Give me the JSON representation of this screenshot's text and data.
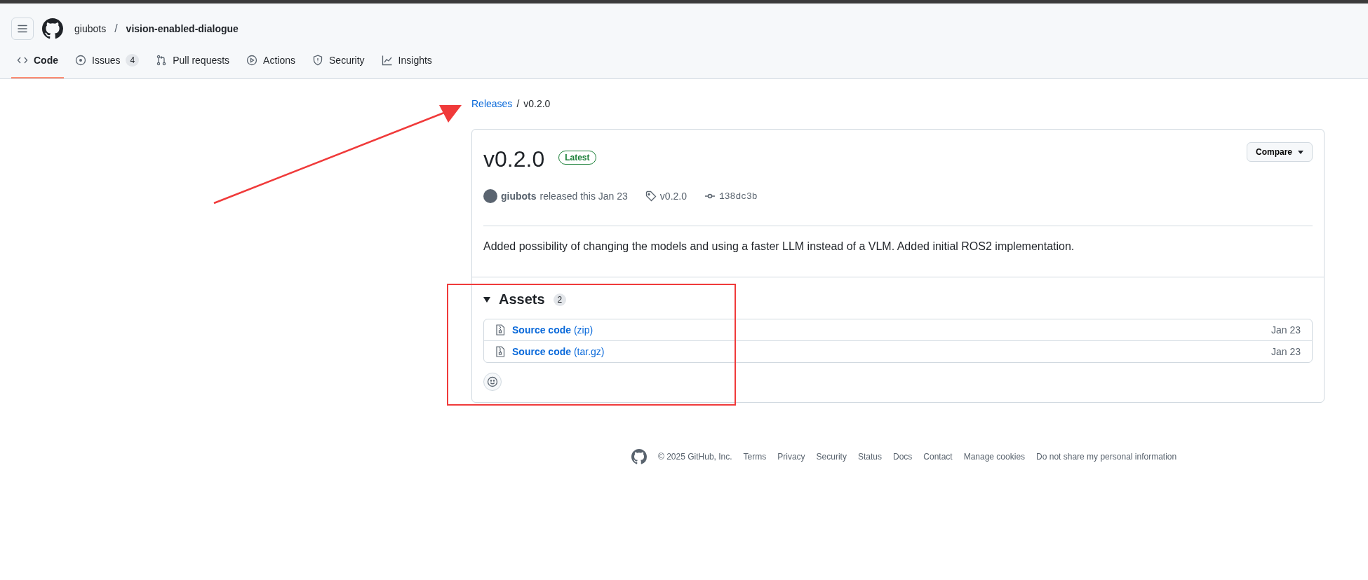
{
  "header": {
    "owner": "giubots",
    "separator": "/",
    "repo": "vision-enabled-dialogue"
  },
  "tabs": [
    {
      "label": "Code",
      "kind": "code",
      "selected": true
    },
    {
      "label": "Issues",
      "kind": "issues",
      "count": "4",
      "selected": false
    },
    {
      "label": "Pull requests",
      "kind": "pulls",
      "selected": false
    },
    {
      "label": "Actions",
      "kind": "actions",
      "selected": false
    },
    {
      "label": "Security",
      "kind": "security",
      "selected": false
    },
    {
      "label": "Insights",
      "kind": "insights",
      "selected": false
    }
  ],
  "breadcrumb": {
    "link": "Releases",
    "separator": "/",
    "current": "v0.2.0"
  },
  "release": {
    "title": "v0.2.0",
    "badge": "Latest",
    "compare": "Compare",
    "author": "giubots",
    "released": "released this Jan 23",
    "tag": "v0.2.0",
    "commit": "138dc3b",
    "description": "Added possibility of changing the models and using a faster LLM instead of a VLM. Added initial ROS2 implementation.",
    "assets_title": "Assets",
    "assets_count": "2",
    "assets_expanded": true,
    "assets": [
      {
        "name": "Source code",
        "format": "(zip)",
        "date": "Jan 23"
      },
      {
        "name": "Source code",
        "format": "(tar.gz)",
        "date": "Jan 23"
      }
    ]
  },
  "footer": {
    "copyright": "© 2025 GitHub, Inc.",
    "links": [
      "Terms",
      "Privacy",
      "Security",
      "Status",
      "Docs",
      "Contact",
      "Manage cookies",
      "Do not share my personal information"
    ]
  }
}
